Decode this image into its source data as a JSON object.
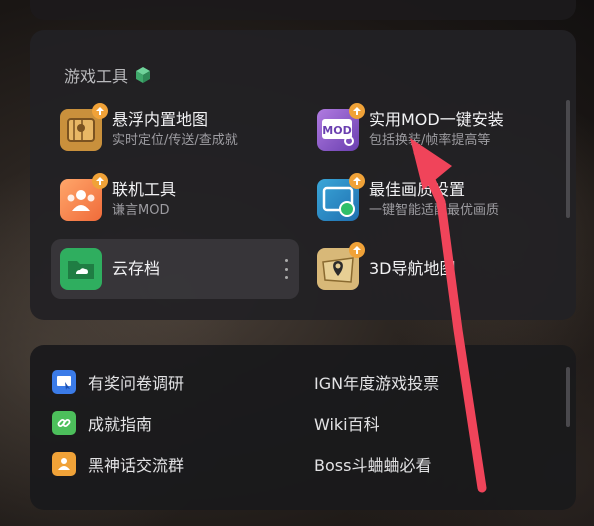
{
  "tools_section": {
    "title": "游戏工具",
    "tools": [
      {
        "name": "悬浮内置地图",
        "desc": "实时定位/传送/查成就",
        "icon": "map-icon"
      },
      {
        "name": "实用MOD一键安装",
        "desc": "包括换装/帧率提高等",
        "icon": "mod-icon",
        "icon_text": "MOD"
      },
      {
        "name": "联机工具",
        "desc": "谦言MOD",
        "icon": "multiplayer-icon"
      },
      {
        "name": "最佳画质设置",
        "desc": "一键智能适配最优画质",
        "icon": "display-settings-icon"
      },
      {
        "name": "云存档",
        "desc": "",
        "icon": "cloud-folder-icon"
      },
      {
        "name": "3D导航地图",
        "desc": "",
        "icon": "3d-map-icon"
      }
    ]
  },
  "links_section": {
    "left": [
      {
        "label": "有奖问卷调研",
        "icon": "survey-icon",
        "color": "#3b7be8"
      },
      {
        "label": "成就指南",
        "icon": "link-icon",
        "color": "#4cbf5b"
      },
      {
        "label": "黑神话交流群",
        "icon": "group-icon",
        "color": "#f0a238"
      }
    ],
    "right": [
      {
        "label": "IGN年度游戏投票"
      },
      {
        "label": "Wiki百科"
      },
      {
        "label": "Boss斗蛐蛐必看"
      }
    ]
  },
  "colors": {
    "accent_orange": "#f0a238",
    "arrow_red": "#f0445a"
  }
}
